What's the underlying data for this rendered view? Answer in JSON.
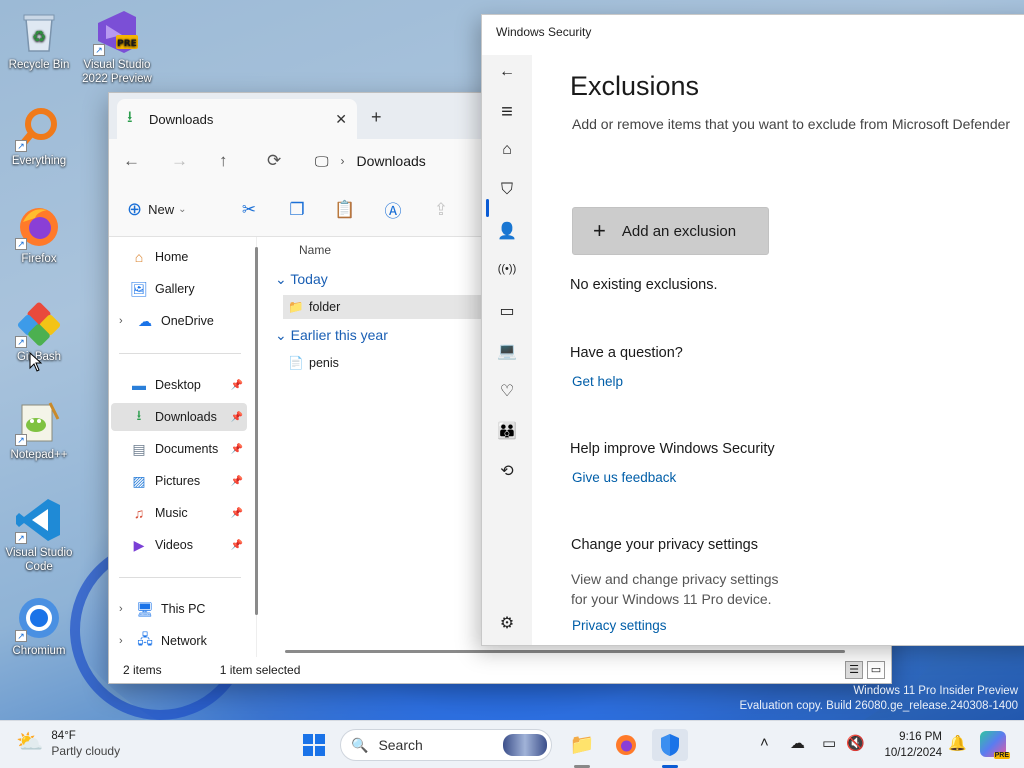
{
  "desktop": {
    "icons": [
      {
        "label": "Recycle Bin",
        "icon": "recycle-bin-icon",
        "glyph": "♻"
      },
      {
        "label": "Visual Studio 2022 Preview",
        "icon": "visual-studio-icon",
        "badge": "PRE"
      },
      {
        "label": "Everything",
        "icon": "everything-search-icon"
      },
      {
        "label": "Firefox",
        "icon": "firefox-icon"
      },
      {
        "label": "Git Bash",
        "icon": "git-bash-icon"
      },
      {
        "label": "Notepad++",
        "icon": "notepad-plus-plus-icon"
      },
      {
        "label": "Visual Studio Code",
        "icon": "vscode-icon"
      },
      {
        "label": "Chromium",
        "icon": "chromium-icon"
      }
    ]
  },
  "explorer": {
    "tab_title": "Downloads",
    "tab_close": "✕",
    "new_tab": "+",
    "nav": {
      "back": "←",
      "forward": "→",
      "up": "↑",
      "refresh": "⟳",
      "pc_glyph": "🖵",
      "chevron": "›",
      "breadcrumb": "Downloads"
    },
    "toolbar": {
      "new_label": "New",
      "new_caret": "⌄",
      "cut": "✂",
      "copy": "❐",
      "paste": "📋",
      "rename": "Ⓐ",
      "share": "⇪",
      "delete": "🗑"
    },
    "sidebar": {
      "items": [
        {
          "label": "Home",
          "glyph": "⌂",
          "pinned": false,
          "expandable": false
        },
        {
          "label": "Gallery",
          "glyph": "🖼",
          "pinned": false,
          "expandable": false
        },
        {
          "label": "OneDrive",
          "glyph": "☁",
          "pinned": false,
          "expandable": true
        },
        {
          "label": "Desktop",
          "glyph": "▬",
          "pinned": true,
          "expandable": false
        },
        {
          "label": "Downloads",
          "glyph": "⭳",
          "pinned": true,
          "expandable": false,
          "selected": true
        },
        {
          "label": "Documents",
          "glyph": "▤",
          "pinned": true,
          "expandable": false
        },
        {
          "label": "Pictures",
          "glyph": "▨",
          "pinned": true,
          "expandable": false
        },
        {
          "label": "Music",
          "glyph": "♫",
          "pinned": true,
          "expandable": false
        },
        {
          "label": "Videos",
          "glyph": "▶",
          "pinned": true,
          "expandable": false
        },
        {
          "label": "This PC",
          "glyph": "🖥",
          "pinned": false,
          "expandable": true
        },
        {
          "label": "Network",
          "glyph": "🖧",
          "pinned": false,
          "expandable": true
        }
      ],
      "pin_glyph": "📌",
      "expand_glyph": "›"
    },
    "column_header": "Name",
    "groups": [
      {
        "label": "Today",
        "glyph": "⌄",
        "files": [
          {
            "name": "folder",
            "glyph": "📁",
            "selected": true
          }
        ]
      },
      {
        "label": "Earlier this year",
        "glyph": "⌄",
        "files": [
          {
            "name": "penis",
            "glyph": "📄",
            "selected": false
          }
        ]
      }
    ],
    "status": {
      "count": "2 items",
      "selection": "1 item selected"
    },
    "view_buttons": {
      "details": "☰",
      "tiles": "▭"
    }
  },
  "security": {
    "window_title": "Windows Security",
    "rail": {
      "back": "←",
      "menu": "≡",
      "home": "⌂",
      "shield": "⛉",
      "account": "👤",
      "firewall": "((•))",
      "app": "▭",
      "device": "💻",
      "health": "♡",
      "family": "👪",
      "history": "⟲",
      "settings": "⚙"
    },
    "heading": "Exclusions",
    "subtitle": "Add or remove items that you want to exclude from Microsoft Defender",
    "add_button": {
      "plus": "+",
      "label": "Add an exclusion"
    },
    "no_exclusions": "No existing exclusions.",
    "question_heading": "Have a question?",
    "get_help": "Get help",
    "improve_heading": "Help improve Windows Security",
    "feedback_link": "Give us feedback",
    "privacy_heading": "Change your privacy settings",
    "privacy_text_1": "View and change privacy settings",
    "privacy_text_2": "for your Windows 11 Pro device.",
    "privacy_link": "Privacy settings"
  },
  "watermark": {
    "line1": "Windows 11 Pro Insider Preview",
    "line2": "Evaluation copy. Build 26080.ge_release.240308-1400"
  },
  "taskbar": {
    "weather_temp": "84°F",
    "weather_desc": "Partly cloudy",
    "weather_glyph": "⛅",
    "start_glyph": "⊞",
    "search_glyph": "🔍",
    "search_placeholder": "Search",
    "explorer_glyph": "📁",
    "firefox_glyph": "🦊",
    "security_glyph": "🛡",
    "tray": {
      "chevron": "˄",
      "onedrive": "☁",
      "network": "▭",
      "volume": "🔇",
      "bell": "🔔"
    },
    "time": "9:16 PM",
    "date": "10/12/2024",
    "copilot_badge": "PRE"
  },
  "colors": {
    "accent": "#0a5bd4",
    "link": "#005ea8",
    "download_green": "#2e9e4f"
  }
}
